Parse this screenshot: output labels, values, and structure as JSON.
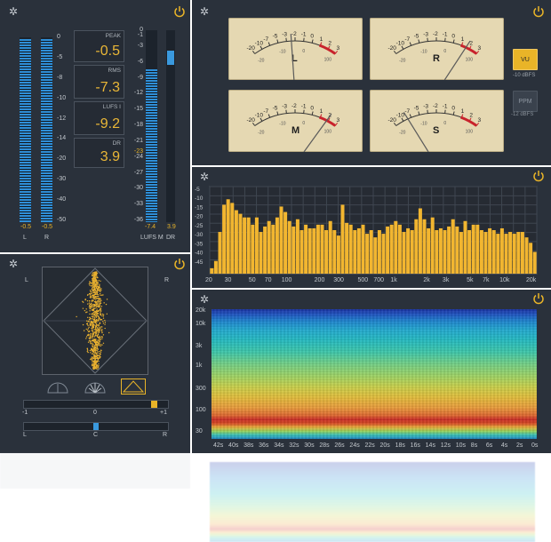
{
  "levels": {
    "scale": [
      "0",
      "-5",
      "-8",
      "-10",
      "-12",
      "-14",
      "-20",
      "-30",
      "-40",
      "-50"
    ],
    "peak_left": "-0.5",
    "peak_right": "-0.5",
    "ch_left": "L",
    "ch_right": "R",
    "level_left_db": -0.5,
    "level_right_db": -0.5
  },
  "readouts": [
    {
      "title": "PEAK",
      "value": "-0.5"
    },
    {
      "title": "RMS",
      "value": "-7.3"
    },
    {
      "title": "LUFS I",
      "value": "-9.2"
    },
    {
      "title": "DR",
      "value": "3.9"
    }
  ],
  "lufs": {
    "scale": [
      "0",
      "-1",
      "-3",
      "-6",
      "-9",
      "-12",
      "-15",
      "-18",
      "-21",
      "-23",
      "-24",
      "-27",
      "-30",
      "-33",
      "-36"
    ],
    "highlight_tick": "-23",
    "value_m": "-7.4",
    "value_dr": "3.9",
    "label_m": "LUFS M",
    "label_dr": "DR",
    "level_m": -7.4,
    "level_dr": 3.9
  },
  "vu": {
    "scale_top": [
      "-20",
      "-10",
      "-7",
      "-5",
      "-3",
      "-2",
      "-1",
      "0",
      "1",
      "2",
      "3"
    ],
    "scale_inner": [
      "-20",
      "-10",
      "0",
      "100"
    ],
    "meters": [
      "L",
      "R",
      "M",
      "S"
    ],
    "mode_vu": "VU",
    "mode_vu_ref": "-10 dBFS",
    "mode_ppm": "PPM",
    "mode_ppm_ref": "-12 dBFS"
  },
  "spectrum": {
    "y_ticks": [
      "-5",
      "-10",
      "-15",
      "-20",
      "-25",
      "-30",
      "-35",
      "-40",
      "-45"
    ],
    "x_ticks": [
      "20",
      "30",
      "50",
      "70",
      "100",
      "200",
      "300",
      "500",
      "700",
      "1k",
      "2k",
      "3k",
      "5k",
      "7k",
      "10k",
      "20k"
    ],
    "bars_db": [
      -47,
      -43,
      -27,
      -12,
      -9,
      -11,
      -15,
      -17,
      -19,
      -19,
      -23,
      -19,
      -27,
      -24,
      -21,
      -23,
      -19,
      -13,
      -16,
      -21,
      -24,
      -20,
      -26,
      -23,
      -25,
      -25,
      -23,
      -23,
      -26,
      -21,
      -26,
      -29,
      -12,
      -22,
      -23,
      -26,
      -25,
      -23,
      -28,
      -26,
      -30,
      -26,
      -28,
      -24,
      -23,
      -21,
      -23,
      -27,
      -25,
      -26,
      -20,
      -14,
      -20,
      -25,
      -19,
      -26,
      -25,
      -26,
      -24,
      -20,
      -24,
      -27,
      -21,
      -26,
      -23,
      -23,
      -26,
      -27,
      -25,
      -26,
      -28,
      -25,
      -28,
      -27,
      -28,
      -27,
      -27,
      -30,
      -33,
      -38
    ]
  },
  "spectrogram": {
    "y_ticks": [
      "20k",
      "10k",
      "3k",
      "1k",
      "300",
      "100",
      "30"
    ],
    "x_ticks": [
      "42s",
      "40s",
      "38s",
      "36s",
      "34s",
      "32s",
      "30s",
      "28s",
      "26s",
      "24s",
      "22s",
      "20s",
      "18s",
      "16s",
      "14s",
      "12s",
      "10s",
      "8s",
      "6s",
      "4s",
      "2s",
      "0s"
    ]
  },
  "stereo": {
    "ch_left": "L",
    "ch_right": "R",
    "corr_left": "-1",
    "corr_mid": "0",
    "corr_right": "+1",
    "corr_value": 0.85,
    "bal_left": "L",
    "bal_mid": "C",
    "bal_right": "R",
    "bal_value": 0.0
  },
  "colors": {
    "panel": "#2a313b",
    "accent": "#e9b428",
    "meter_blue": "#2f8fd8",
    "red": "#c8232c"
  },
  "icons": [
    "gear-icon",
    "power-icon",
    "polar-icon",
    "lissajous-icon",
    "diamond-icon"
  ]
}
